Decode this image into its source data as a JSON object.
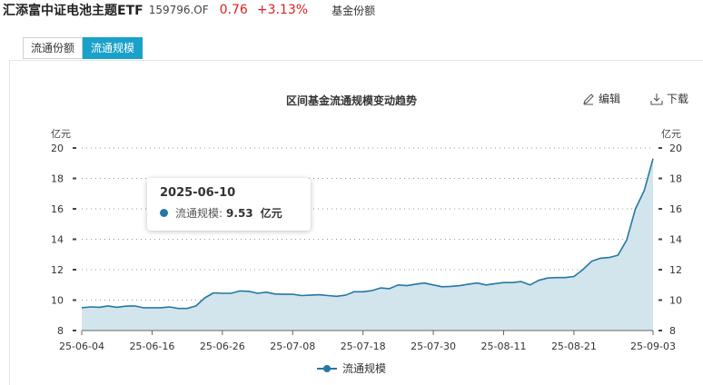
{
  "header": {
    "fund_name": "汇添富中证电池主题ETF",
    "fund_code": "159796.OF",
    "price": "0.76",
    "change_pct": "+3.13%",
    "link_label": "基金份额",
    "price_color": "#e02020"
  },
  "tabs": [
    {
      "label": "流通份额",
      "active": false
    },
    {
      "label": "流通规模",
      "active": true
    }
  ],
  "toolbar": {
    "edit_label": "编辑",
    "edit_icon": "pencil-icon",
    "download_label": "下载",
    "download_icon": "download-icon"
  },
  "tooltip": {
    "date": "2025-06-10",
    "series_label": "流通规模:",
    "value": "9.53",
    "unit": "亿元"
  },
  "chart_data": {
    "type": "area",
    "title": "区间基金流通规模变动趋势",
    "y_unit_left": "亿元",
    "y_unit_right": "亿元",
    "ylim": [
      8,
      20
    ],
    "yticks": [
      8,
      10,
      12,
      14,
      16,
      18,
      20
    ],
    "x_tick_labels": [
      "25-06-04",
      "25-06-16",
      "25-06-26",
      "25-07-08",
      "25-07-18",
      "25-07-30",
      "25-08-11",
      "25-08-21",
      "25-09-03"
    ],
    "grid": true,
    "legend_position": "bottom",
    "series": [
      {
        "name": "流通规模",
        "color": "#2578a5",
        "fill": "#d2e4ec",
        "x": [
          "2025-06-04",
          "2025-06-05",
          "2025-06-06",
          "2025-06-09",
          "2025-06-10",
          "2025-06-11",
          "2025-06-12",
          "2025-06-13",
          "2025-06-16",
          "2025-06-17",
          "2025-06-18",
          "2025-06-19",
          "2025-06-20",
          "2025-06-23",
          "2025-06-24",
          "2025-06-25",
          "2025-06-26",
          "2025-06-27",
          "2025-06-30",
          "2025-07-01",
          "2025-07-02",
          "2025-07-03",
          "2025-07-04",
          "2025-07-07",
          "2025-07-08",
          "2025-07-09",
          "2025-07-10",
          "2025-07-11",
          "2025-07-14",
          "2025-07-15",
          "2025-07-16",
          "2025-07-17",
          "2025-07-18",
          "2025-07-21",
          "2025-07-22",
          "2025-07-23",
          "2025-07-24",
          "2025-07-25",
          "2025-07-28",
          "2025-07-29",
          "2025-07-30",
          "2025-07-31",
          "2025-08-01",
          "2025-08-04",
          "2025-08-05",
          "2025-08-06",
          "2025-08-07",
          "2025-08-08",
          "2025-08-11",
          "2025-08-12",
          "2025-08-13",
          "2025-08-14",
          "2025-08-15",
          "2025-08-18",
          "2025-08-19",
          "2025-08-20",
          "2025-08-21",
          "2025-08-22",
          "2025-08-25",
          "2025-08-26",
          "2025-08-27",
          "2025-08-28",
          "2025-08-29",
          "2025-09-01",
          "2025-09-02",
          "2025-09-03"
        ],
        "values": [
          9.5,
          9.55,
          9.53,
          9.62,
          9.53,
          9.6,
          9.62,
          9.5,
          9.5,
          9.5,
          9.55,
          9.45,
          9.45,
          9.62,
          10.15,
          10.48,
          10.45,
          10.45,
          10.6,
          10.58,
          10.45,
          10.52,
          10.4,
          10.38,
          10.38,
          10.3,
          10.32,
          10.35,
          10.3,
          10.25,
          10.32,
          10.55,
          10.55,
          10.62,
          10.8,
          10.75,
          11.0,
          10.95,
          11.05,
          11.12,
          11.0,
          10.88,
          10.9,
          10.95,
          11.05,
          11.12,
          11.0,
          11.08,
          11.15,
          11.15,
          11.22,
          11.0,
          11.3,
          11.45,
          11.48,
          11.48,
          11.55,
          12.0,
          12.55,
          12.75,
          12.8,
          12.95,
          13.95,
          16.0,
          17.2,
          19.3
        ]
      }
    ]
  }
}
